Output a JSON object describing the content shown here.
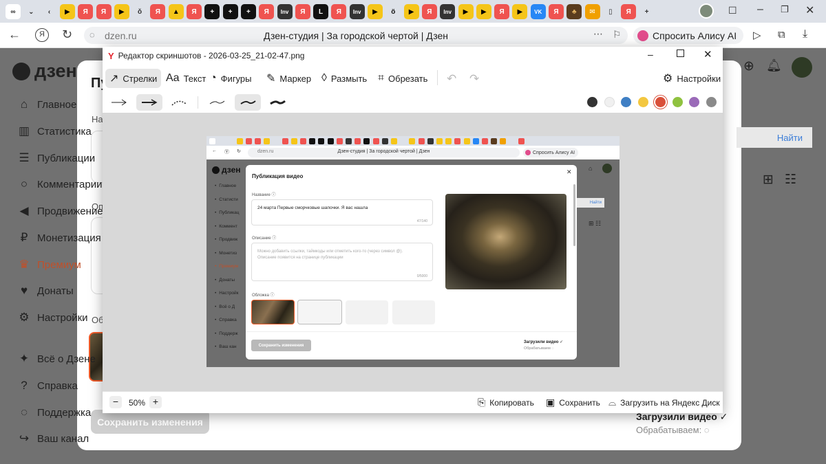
{
  "browser": {
    "tabs": [
      {
        "icon": "infinity-icon",
        "glyph": "∞",
        "color": "#ffffff",
        "fg": "#222"
      },
      {
        "icon": "chevron-down-icon",
        "glyph": "⌄",
        "color": "#dde1e8",
        "fg": "#222"
      },
      {
        "icon": "back-small-icon",
        "glyph": "‹",
        "color": "#dde1e8",
        "fg": "#222"
      },
      {
        "icon": "yt-icon",
        "glyph": "▶",
        "color": "#f5c518",
        "fg": "#000"
      },
      {
        "icon": "ya-icon",
        "glyph": "Я",
        "color": "#ef5350",
        "fg": "#fff"
      },
      {
        "icon": "ya-icon",
        "glyph": "Я",
        "color": "#ef5350",
        "fg": "#fff"
      },
      {
        "icon": "yt-icon",
        "glyph": "▶",
        "color": "#f5c518",
        "fg": "#000"
      },
      {
        "icon": "bottle-icon",
        "glyph": "ǒ",
        "color": "#dde1e8",
        "fg": "#333"
      },
      {
        "icon": "ya-icon",
        "glyph": "Я",
        "color": "#ef5350",
        "fg": "#fff"
      },
      {
        "icon": "image-icon",
        "glyph": "▲",
        "color": "#f5c518",
        "fg": "#000"
      },
      {
        "icon": "ya-icon",
        "glyph": "Я",
        "color": "#ef5350",
        "fg": "#fff"
      },
      {
        "icon": "plus-square-icon",
        "glyph": "+",
        "color": "#111",
        "fg": "#fff"
      },
      {
        "icon": "plus-square-icon",
        "glyph": "+",
        "color": "#111",
        "fg": "#fff"
      },
      {
        "icon": "plus-square-icon",
        "glyph": "+",
        "color": "#111",
        "fg": "#fff"
      },
      {
        "icon": "ya-icon",
        "glyph": "Я",
        "color": "#ef5350",
        "fg": "#fff"
      },
      {
        "icon": "inv-icon",
        "glyph": "Inv",
        "color": "#333",
        "fg": "#fff"
      },
      {
        "icon": "ya-icon",
        "glyph": "Я",
        "color": "#ef5350",
        "fg": "#fff"
      },
      {
        "icon": "l-icon",
        "glyph": "L",
        "color": "#111",
        "fg": "#fff"
      },
      {
        "icon": "ya-icon",
        "glyph": "Я",
        "color": "#ef5350",
        "fg": "#fff"
      },
      {
        "icon": "inv-icon",
        "glyph": "Inv",
        "color": "#333",
        "fg": "#fff"
      },
      {
        "icon": "yt-icon",
        "glyph": "▶",
        "color": "#f5c518",
        "fg": "#000"
      },
      {
        "icon": "eyes-icon",
        "glyph": "ö",
        "color": "#dde1e8",
        "fg": "#111"
      },
      {
        "icon": "yt-icon",
        "glyph": "▶",
        "color": "#f5c518",
        "fg": "#000"
      },
      {
        "icon": "ya-icon",
        "glyph": "Я",
        "color": "#ef5350",
        "fg": "#fff"
      },
      {
        "icon": "inv-icon",
        "glyph": "Inv",
        "color": "#333",
        "fg": "#fff"
      },
      {
        "icon": "yt-icon",
        "glyph": "▶",
        "color": "#f5c518",
        "fg": "#000"
      },
      {
        "icon": "yt-icon",
        "glyph": "▶",
        "color": "#f5c518",
        "fg": "#000"
      },
      {
        "icon": "ya-icon",
        "glyph": "Я",
        "color": "#ef5350",
        "fg": "#fff"
      },
      {
        "icon": "yt-icon",
        "glyph": "▶",
        "color": "#f5c518",
        "fg": "#000"
      },
      {
        "icon": "vk-icon",
        "glyph": "VK",
        "color": "#2787f5",
        "fg": "#fff"
      },
      {
        "icon": "ya-icon",
        "glyph": "Я",
        "color": "#ef5350",
        "fg": "#fff"
      },
      {
        "icon": "mushroom-icon",
        "glyph": "♣",
        "color": "#5a3c1e",
        "fg": "#e0b060"
      },
      {
        "icon": "mail-icon",
        "glyph": "✉",
        "color": "#f0a000",
        "fg": "#fff"
      },
      {
        "icon": "doc-icon",
        "glyph": "▯",
        "color": "#dde1e8",
        "fg": "#333"
      },
      {
        "icon": "ya-icon",
        "glyph": "Я",
        "color": "#ef5350",
        "fg": "#fff"
      },
      {
        "icon": "new-tab-icon",
        "glyph": "+",
        "color": "#dde1e8",
        "fg": "#333"
      }
    ],
    "url": "dzen.ru",
    "page_title": "Дзен-студия | За городской чертой | Дзен",
    "alice_button": "Спросить Алису AI"
  },
  "dzen": {
    "logo": "дзен",
    "side_items": [
      {
        "label": "Главное",
        "icon": "home-icon",
        "glyph": "⌂"
      },
      {
        "label": "Статистика",
        "icon": "stats-icon",
        "glyph": "▥"
      },
      {
        "label": "Публикации",
        "icon": "publications-icon",
        "glyph": "☰"
      },
      {
        "label": "Комментарии",
        "icon": "comments-icon",
        "glyph": "○"
      },
      {
        "label": "Продвижение",
        "icon": "promo-icon",
        "glyph": "◀"
      },
      {
        "label": "Монетизация",
        "icon": "ruble-icon",
        "glyph": "₽"
      },
      {
        "label": "Премиум",
        "icon": "crown-icon",
        "glyph": "♛"
      },
      {
        "label": "Донаты",
        "icon": "donate-icon",
        "glyph": "♥"
      },
      {
        "label": "Настройки",
        "icon": "settings-icon",
        "glyph": "⚙"
      },
      {
        "label": "Всё о Дзене",
        "icon": "zen-icon",
        "glyph": "✦"
      },
      {
        "label": "Справка",
        "icon": "help-icon",
        "glyph": "?"
      },
      {
        "label": "Поддержка",
        "icon": "support-icon",
        "glyph": "◌"
      },
      {
        "label": "Ваш канал",
        "icon": "channel-icon",
        "glyph": "↪"
      }
    ],
    "save_button": "Сохранить изменения",
    "uploaded": "Загрузили видео",
    "processing": "Обрабатываем:",
    "find": "Найти",
    "partial_title": "Пу",
    "partial_name": "На",
    "partial_desc": "Оп",
    "partial_cover": "Об"
  },
  "editor": {
    "title": "Редактор скриншотов - 2026-03-25_21-02-47.png",
    "tools": [
      {
        "label": "Стрелки",
        "icon": "arrow-tool-icon",
        "glyph": "↗"
      },
      {
        "label": "Текст",
        "icon": "text-tool-icon",
        "glyph": "Aa"
      },
      {
        "label": "Фигуры",
        "icon": "shapes-tool-icon",
        "glyph": "◔"
      },
      {
        "label": "Маркер",
        "icon": "marker-tool-icon",
        "glyph": "✎"
      },
      {
        "label": "Размыть",
        "icon": "blur-tool-icon",
        "glyph": "◊"
      },
      {
        "label": "Обрезать",
        "icon": "crop-tool-icon",
        "glyph": "⌗"
      }
    ],
    "settings": "Настройки",
    "colors": [
      "#333333",
      "#f0f0f0",
      "#3f7fc4",
      "#f3c740",
      "#d9503a",
      "#8fc23f",
      "#9a6ab8",
      "#8a8a8a"
    ],
    "selected_color": "#d9503a",
    "zoom": "50%",
    "copy": "Копировать",
    "save": "Сохранить",
    "upload": "Загрузить на Яндекс Диск"
  },
  "shot": {
    "url": "dzen.ru",
    "page_title": "Дзен-студия | За городской чертой | Дзен",
    "alice": "Спросить Алису AI",
    "logo": "дзен",
    "modal_title": "Публикация видео",
    "name_label": "Название",
    "name_value": "24 марта Первые сморчковые шапочки. Я вас нашла",
    "name_counter": "47/140",
    "desc_label": "Описание",
    "desc_placeholder": "Можно добавить ссылки, таймкоды или отметить кого-то (через символ @). Описание появится на странице публикации",
    "desc_counter": "0/5000",
    "cover_label": "Обложка",
    "save": "Сохранить изменения",
    "uploaded": "Загрузили видео",
    "processing": "Обрабатываем",
    "find": "Найти",
    "side": [
      "Главное",
      "Статисти",
      "Публикац",
      "Коммент",
      "Продвиж",
      "Монетиз",
      "Премиум",
      "Донаты",
      "Настройк",
      "Всё о Д",
      "Справка",
      "Поддерж",
      "Ваш кан"
    ]
  }
}
